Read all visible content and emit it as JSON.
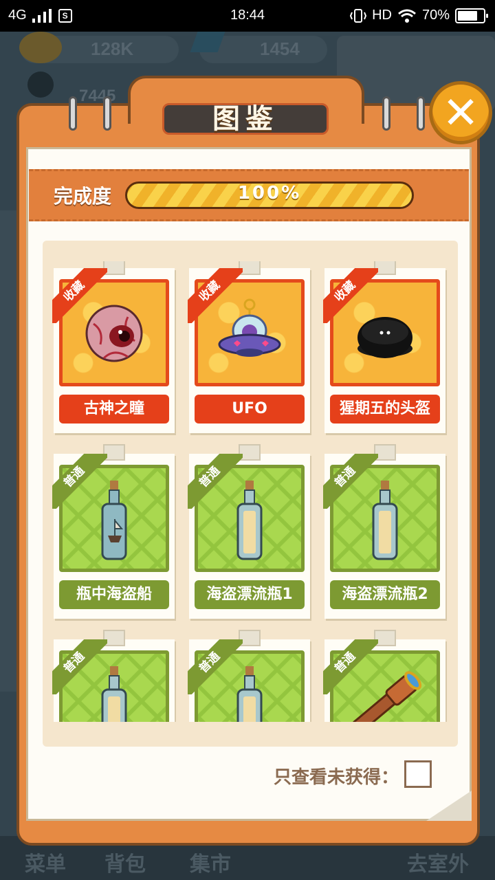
{
  "status_bar": {
    "network": "4G",
    "sim_label": "S",
    "time": "18:44",
    "hd": "HD",
    "battery": "70%"
  },
  "background_hud": {
    "coins": "128K",
    "gems": "1454",
    "level": "7445",
    "tabs": [
      "菜单",
      "背包",
      "集市",
      "去室外"
    ]
  },
  "album": {
    "title": "图鉴",
    "close_icon": "close-icon",
    "progress_label": "完成度",
    "progress_text": "100%",
    "progress_value": 1.0,
    "items": [
      {
        "name": "古神之瞳",
        "rarity": "收藏",
        "icon": "eyeball-icon"
      },
      {
        "name": "UFO",
        "rarity": "收藏",
        "icon": "ufo-icon"
      },
      {
        "name": "猩期五的头盔",
        "rarity": "收藏",
        "icon": "helmet-icon"
      },
      {
        "name": "瓶中海盗船",
        "rarity": "普通",
        "icon": "ship-in-bottle-icon"
      },
      {
        "name": "海盗漂流瓶1",
        "rarity": "普通",
        "icon": "message-bottle-icon"
      },
      {
        "name": "海盗漂流瓶2",
        "rarity": "普通",
        "icon": "message-bottle-icon"
      },
      {
        "name": "",
        "rarity": "普通",
        "icon": "message-bottle-icon"
      },
      {
        "name": "",
        "rarity": "普通",
        "icon": "message-bottle-icon"
      },
      {
        "name": "",
        "rarity": "普通",
        "icon": "telescope-icon"
      }
    ],
    "filter_label": "只查看未获得：",
    "filter_checked": false
  },
  "colors": {
    "rare": "#e5401a",
    "common": "#7d9a32",
    "album_orange": "#e68a43",
    "close_gold": "#f2a520"
  }
}
